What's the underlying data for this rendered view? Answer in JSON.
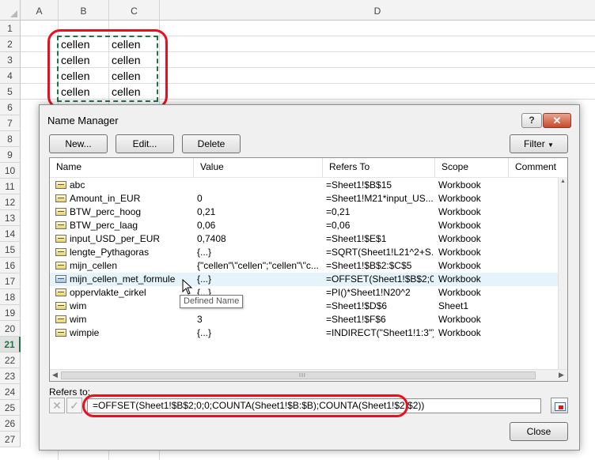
{
  "sheet": {
    "columns": [
      "A",
      "B",
      "C",
      "D"
    ],
    "rows": [
      "1",
      "2",
      "3",
      "4",
      "5",
      "6",
      "7",
      "8",
      "9",
      "10",
      "11",
      "12",
      "13",
      "14",
      "15",
      "16",
      "17",
      "18",
      "19",
      "20",
      "21",
      "22",
      "23",
      "24",
      "25",
      "26",
      "27"
    ],
    "active_row": "21",
    "cells": {
      "b2": "cellen",
      "c2": "cellen",
      "b3": "cellen",
      "c3": "cellen",
      "b4": "cellen",
      "c4": "cellen",
      "b5": "cellen",
      "c5": "cellen"
    }
  },
  "dialog": {
    "title": "Name Manager",
    "help_label": "?",
    "close_x_label": "✕",
    "buttons": {
      "new": "New...",
      "edit": "Edit...",
      "delete": "Delete",
      "filter": "Filter",
      "close": "Close"
    },
    "list": {
      "headers": {
        "name": "Name",
        "value": "Value",
        "refers_to": "Refers To",
        "scope": "Scope",
        "comment": "Comment"
      },
      "rows": [
        {
          "name": "abc",
          "value": "",
          "refers_to": "=Sheet1!$B$15",
          "scope": "Workbook",
          "comment": ""
        },
        {
          "name": "Amount_in_EUR",
          "value": "0",
          "refers_to": "=Sheet1!M21*input_US...",
          "scope": "Workbook",
          "comment": ""
        },
        {
          "name": "BTW_perc_hoog",
          "value": "0,21",
          "refers_to": "=0,21",
          "scope": "Workbook",
          "comment": ""
        },
        {
          "name": "BTW_perc_laag",
          "value": "0,06",
          "refers_to": "=0,06",
          "scope": "Workbook",
          "comment": ""
        },
        {
          "name": "input_USD_per_EUR",
          "value": "0,7408",
          "refers_to": "=Sheet1!$E$1",
          "scope": "Workbook",
          "comment": ""
        },
        {
          "name": "lengte_Pythagoras",
          "value": "{...}",
          "refers_to": "=SQRT(Sheet1!L21^2+S...",
          "scope": "Workbook",
          "comment": ""
        },
        {
          "name": "mijn_cellen",
          "value": "{\"cellen\"\\\"cellen\";\"cellen\"\\\"c...",
          "refers_to": "=Sheet1!$B$2:$C$5",
          "scope": "Workbook",
          "comment": ""
        },
        {
          "name": "mijn_cellen_met_formule",
          "value": "{...}",
          "refers_to": "=OFFSET(Sheet1!$B$2;0...",
          "scope": "Workbook",
          "comment": ""
        },
        {
          "name": "oppervlakte_cirkel",
          "value": "{...}",
          "refers_to": "=PI()*Sheet1!N20^2",
          "scope": "Workbook",
          "comment": ""
        },
        {
          "name": "wim",
          "value": "",
          "refers_to": "=Sheet1!$D$6",
          "scope": "Sheet1",
          "comment": ""
        },
        {
          "name": "wim",
          "value": "3",
          "refers_to": "=Sheet1!$F$6",
          "scope": "Workbook",
          "comment": ""
        },
        {
          "name": "wimpie",
          "value": "{...}",
          "refers_to": "=INDIRECT(\"Sheet1!1:3\")",
          "scope": "Workbook",
          "comment": ""
        }
      ],
      "hovered_row": 7,
      "scroll_grip": "III"
    },
    "tooltip": "Defined Name",
    "refers_to_label": "Refers to:",
    "refers_to_value": "=OFFSET(Sheet1!$B$2;0;0;COUNTA(Sheet1!$B:$B);COUNTA(Sheet1!$2:$2))"
  },
  "icons": {
    "name_icon": "defined-name-icon",
    "table_icon": "named-range-icon",
    "cancel_icon": "cancel-x-icon",
    "confirm_icon": "confirm-check-icon",
    "collapse_icon": "collapse-dialog-icon"
  },
  "colors": {
    "annotation_red": "#e8101c",
    "selection_green": "#217346",
    "hover_blue": "#e5f3fb"
  }
}
